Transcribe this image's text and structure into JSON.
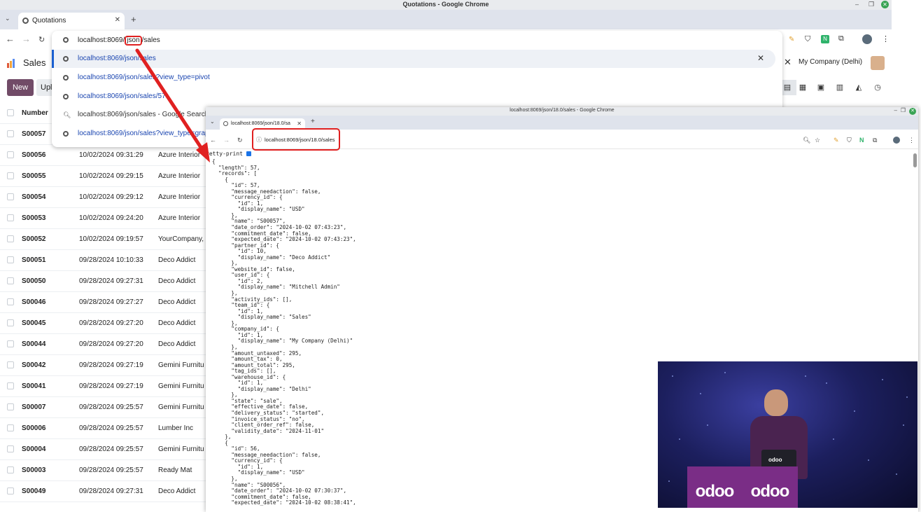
{
  "background_window": {
    "title": "Quotations - Google Chrome",
    "tab_label": "Quotations",
    "omnibox": {
      "text_before": "localhost:8069/",
      "text_highlight": "json",
      "text_after": "/sales",
      "suggestions": [
        {
          "text": "localhost:8069/json/sales"
        },
        {
          "text": "localhost:8069/json/sales?view_type=pivot"
        },
        {
          "text": "localhost:8069/json/sales/57"
        },
        {
          "text": "localhost:8069/json/sales - Google Search"
        },
        {
          "text": "localhost:8069/json/sales?view_type=grap"
        }
      ]
    },
    "odoo": {
      "app_name": "Sales",
      "company": "My Company (Delhi)",
      "new_label": "New",
      "upload_label": "Upl",
      "table_header": {
        "number": "Number"
      },
      "rows": [
        {
          "number": "S00057",
          "date": "",
          "customer": ""
        },
        {
          "number": "S00056",
          "date": "10/02/2024 09:31:29",
          "customer": "Azure Interior"
        },
        {
          "number": "S00055",
          "date": "10/02/2024 09:29:15",
          "customer": "Azure Interior"
        },
        {
          "number": "S00054",
          "date": "10/02/2024 09:29:12",
          "customer": "Azure Interior"
        },
        {
          "number": "S00053",
          "date": "10/02/2024 09:24:20",
          "customer": "Azure Interior"
        },
        {
          "number": "S00052",
          "date": "10/02/2024 09:19:57",
          "customer": "YourCompany,"
        },
        {
          "number": "S00051",
          "date": "09/28/2024 10:10:33",
          "customer": "Deco Addict"
        },
        {
          "number": "S00050",
          "date": "09/28/2024 09:27:31",
          "customer": "Deco Addict"
        },
        {
          "number": "S00046",
          "date": "09/28/2024 09:27:27",
          "customer": "Deco Addict"
        },
        {
          "number": "S00045",
          "date": "09/28/2024 09:27:20",
          "customer": "Deco Addict"
        },
        {
          "number": "S00044",
          "date": "09/28/2024 09:27:20",
          "customer": "Deco Addict"
        },
        {
          "number": "S00042",
          "date": "09/28/2024 09:27:19",
          "customer": "Gemini Furnitu"
        },
        {
          "number": "S00041",
          "date": "09/28/2024 09:27:19",
          "customer": "Gemini Furnitu"
        },
        {
          "number": "S00007",
          "date": "09/28/2024 09:25:57",
          "customer": "Gemini Furnitu"
        },
        {
          "number": "S00006",
          "date": "09/28/2024 09:25:57",
          "customer": "Lumber Inc"
        },
        {
          "number": "S00004",
          "date": "09/28/2024 09:25:57",
          "customer": "Gemini Furnitu"
        },
        {
          "number": "S00003",
          "date": "09/28/2024 09:25:57",
          "customer": "Ready Mat"
        },
        {
          "number": "S00049",
          "date": "09/28/2024 09:27:31",
          "customer": "Deco Addict"
        }
      ]
    }
  },
  "foreground_window": {
    "title": "localhost:8069/json/18.0/sales - Google Chrome",
    "tab_label": "localhost:8069/json/18.0/sa",
    "url": "localhost:8069/json/18.0/sales",
    "pretty_print_label": "retty-print",
    "json_text": "{\n  \"length\": 57,\n  \"records\": [\n    {\n      \"id\": 57,\n      \"message_needaction\": false,\n      \"currency_id\": {\n        \"id\": 1,\n        \"display_name\": \"USD\"\n      },\n      \"name\": \"S00057\",\n      \"date_order\": \"2024-10-02 07:43:23\",\n      \"commitment_date\": false,\n      \"expected_date\": \"2024-10-02 07:43:23\",\n      \"partner_id\": {\n        \"id\": 10,\n        \"display_name\": \"Deco Addict\"\n      },\n      \"website_id\": false,\n      \"user_id\": {\n        \"id\": 2,\n        \"display_name\": \"Mitchell Admin\"\n      },\n      \"activity_ids\": [],\n      \"team_id\": {\n        \"id\": 1,\n        \"display_name\": \"Sales\"\n      },\n      \"company_id\": {\n        \"id\": 1,\n        \"display_name\": \"My Company (Delhi)\"\n      },\n      \"amount_untaxed\": 295,\n      \"amount_tax\": 0,\n      \"amount_total\": 295,\n      \"tag_ids\": [],\n      \"warehouse_id\": {\n        \"id\": 1,\n        \"display_name\": \"Delhi\"\n      },\n      \"state\": \"sale\",\n      \"effective_date\": false,\n      \"delivery_status\": \"started\",\n      \"invoice_status\": \"no\",\n      \"client_order_ref\": false,\n      \"validity_date\": \"2024-11-01\"\n    },\n    {\n      \"id\": 56,\n      \"message_needaction\": false,\n      \"currency_id\": {\n        \"id\": 1,\n        \"display_name\": \"USD\"\n      },\n      \"name\": \"S00056\",\n      \"date_order\": \"2024-10-02 07:30:37\",\n      \"commitment_date\": false,\n      \"expected_date\": \"2024-10-02 08:38:41\","
  },
  "webcam": {
    "podium_logo": "odoo",
    "laptop_logo": "odoo"
  },
  "colors": {
    "odoo_purple": "#714b67",
    "annotation_red": "#e02020",
    "link_blue": "#1a45b0"
  }
}
